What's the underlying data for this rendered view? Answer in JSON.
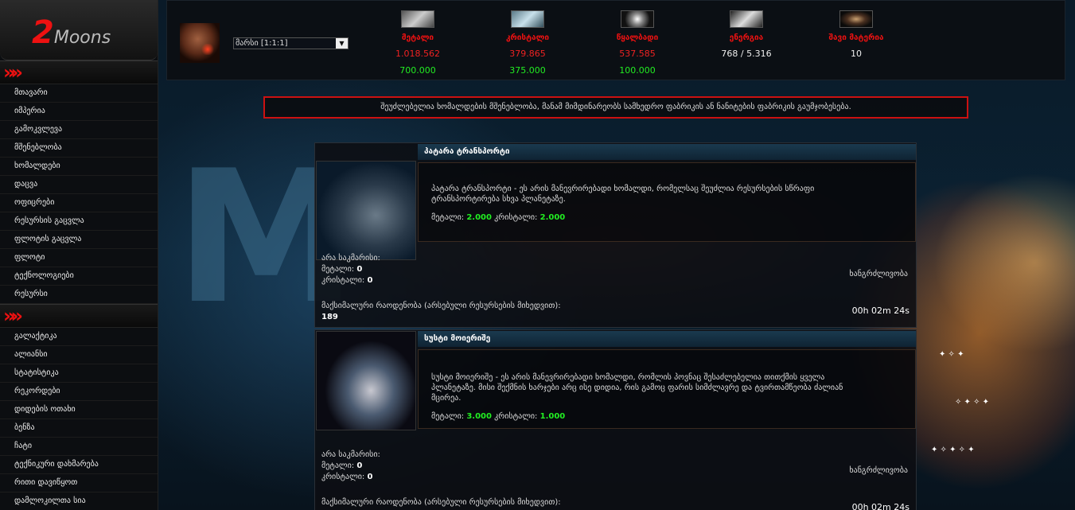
{
  "logo": {
    "two": "2",
    "moons": "Moons"
  },
  "sidebar": {
    "section1_marker": "»",
    "items1": [
      {
        "label": "მთავარი"
      },
      {
        "label": "იმპერია"
      },
      {
        "label": "გამოკვლევა"
      },
      {
        "label": "მშენებლობა"
      },
      {
        "label": "ხომალდები"
      },
      {
        "label": "დაცვა"
      },
      {
        "label": "ოფიცრები"
      },
      {
        "label": "რესურსის გაცვლა"
      },
      {
        "label": "ფლოტის გაცვლა"
      },
      {
        "label": "ფლოტი"
      },
      {
        "label": "ტექნოლოგიები"
      },
      {
        "label": "რესურსი"
      }
    ],
    "section2_marker": "»",
    "items2": [
      {
        "label": "გალაქტიკა"
      },
      {
        "label": "ალიანსი"
      },
      {
        "label": "სტატისტიკა"
      },
      {
        "label": "რეკორდები"
      },
      {
        "label": "დიდების ოთახი"
      },
      {
        "label": "ბენზა"
      },
      {
        "label": "ჩატი"
      },
      {
        "label": "ტექნიკური დახმარება"
      },
      {
        "label": "რითი დავიწყოთ"
      },
      {
        "label": "დამლოკილთა სია"
      }
    ]
  },
  "topbar": {
    "planet_select": "მარსი [1:1:1]",
    "resources": [
      {
        "name": "მეტალი",
        "amount": "1.018.562",
        "production": "700.000",
        "icon": "metal-icon",
        "amount_color": "red"
      },
      {
        "name": "კრისტალი",
        "amount": "379.865",
        "production": "375.000",
        "icon": "crystal-icon",
        "amount_color": "red"
      },
      {
        "name": "წყალბადი",
        "amount": "537.585",
        "production": "100.000",
        "icon": "deuterium-icon",
        "amount_color": "red"
      },
      {
        "name": "ენერგია",
        "amount": "768 / 5.316",
        "production": "",
        "icon": "energy-icon",
        "amount_color": "white"
      },
      {
        "name": "შავი მატერია",
        "amount": "10",
        "production": "",
        "icon": "dark-matter-icon",
        "amount_color": "white"
      }
    ]
  },
  "notice": "შეუძლებელია ხომალდების მშენებლობა, მანამ მიმდინარეობს სამხედრო ფაბრიკის ან ნანიტების ფაბრიკის გაუმჯობესება.",
  "ships": [
    {
      "title": "პატარა ტრანსპორტი",
      "desc1": "პატარა ტრანსპორტი - ეს არის მანევრირებადი ხომალდი, რომელსაც შეუძლია რესურსების სწრაფი",
      "desc2": "ტრანსპორტირება სხვა პლანეტაზე.",
      "desc3": "",
      "cost_metal_label": "მეტალი:",
      "cost_metal": "2.000",
      "cost_crystal_label": "კრისტალი:",
      "cost_crystal": "2.000",
      "info_head": "არა საკმარისი:",
      "info_metal_label": "მეტალი:",
      "info_metal": "0",
      "info_crystal_label": "კრისტალი:",
      "info_crystal": "0",
      "duration_label": "ხანგრძლივობა",
      "max_label": "მაქსიმალური რაოდენობა (არსებული რესურსების მიხედვით):",
      "max_value": "189",
      "time": "00h 02m 24s"
    },
    {
      "title": "სუსტი მოიერიშე",
      "desc1": "სუსტი მოიერიშე - ეს არის მანევრირებადი ხომალდი, რომლის პოვნაც შესაძლებელია თითქმის ყველა",
      "desc2": "პლანეტაზე. მისი შექმნის ხარჯები არც ისე დიდია, რის გამოც ფარის სიმძლავრე და ტვირთამწეობა ძალიან",
      "desc3": "მცირეა.",
      "cost_metal_label": "მეტალი:",
      "cost_metal": "3.000",
      "cost_crystal_label": "კრისტალი:",
      "cost_crystal": "1.000",
      "info_head": "არა საკმარისი:",
      "info_metal_label": "მეტალი:",
      "info_metal": "0",
      "info_crystal_label": "კრისტალი:",
      "info_crystal": "0",
      "duration_label": "ხანგრძლივობა",
      "max_label": "მაქსიმალური რაოდენობა (არსებული რესურსების მიხედვით):",
      "max_value": "",
      "time": "00h 02m 24s"
    }
  ]
}
